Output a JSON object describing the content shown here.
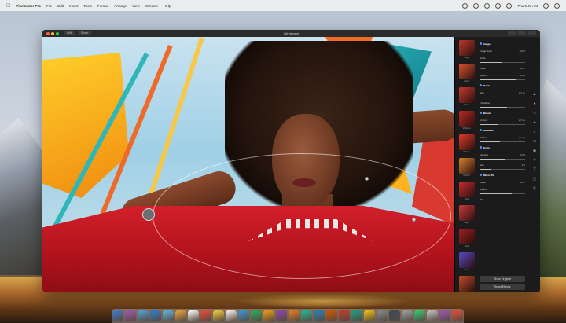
{
  "menubar": {
    "app_name": "Pixelmator Pro",
    "menus": [
      "File",
      "Edit",
      "Insert",
      "Tools",
      "Format",
      "Arrange",
      "View",
      "Window",
      "Help"
    ],
    "clock": "Thu 9:41 AM"
  },
  "window": {
    "title": "Windswept",
    "toolbar_buttons": [
      "Edit",
      "Share"
    ]
  },
  "panel": {
    "thumbnails": [
      {
        "label": "Image",
        "color": "#c0392b"
      },
      {
        "label": "Warm",
        "color": "#d9532f"
      },
      {
        "label": "Tones",
        "color": "#c43a2c"
      },
      {
        "label": "Shadows",
        "color": "#b82a22"
      },
      {
        "label": "Pattern",
        "color": "#e03a2a"
      },
      {
        "label": "Colorful",
        "color": "#d9802a"
      },
      {
        "label": "Vivid",
        "color": "#c72c2f"
      },
      {
        "label": "Bright",
        "color": "#ce3a3a"
      },
      {
        "label": "Dark",
        "color": "#a01e1e"
      },
      {
        "label": "Glow",
        "color": "#5a4ac7"
      },
      {
        "label": "Retro",
        "color": "#c0502a"
      }
    ],
    "settings": [
      {
        "label": "Image",
        "value": "",
        "header": true
      },
      {
        "label": "Image Ratio",
        "value": "100%",
        "header": false
      },
      {
        "label": "Scale",
        "value": "",
        "header": false,
        "slider": 0.5
      },
      {
        "label": "Angle",
        "value": "100°",
        "header": false
      },
      {
        "label": "Opacity",
        "value": "100%",
        "header": false,
        "slider": 0.8
      },
      {
        "label": "Pinch",
        "value": "",
        "header": true
      },
      {
        "label": "Size",
        "value": "2.6 px",
        "header": false,
        "slider": 0.3
      },
      {
        "label": "Transition",
        "value": "",
        "header": false,
        "slider": 0.6
      },
      {
        "label": "Bloom",
        "value": "",
        "header": true
      },
      {
        "label": "Amount",
        "value": "2.5 px",
        "header": false,
        "slider": 0.4
      },
      {
        "label": "Diameter",
        "value": "",
        "header": true
      },
      {
        "label": "Radius",
        "value": "3.2 px",
        "header": false,
        "slider": 0.45
      },
      {
        "label": "Grain",
        "value": "",
        "header": true
      },
      {
        "label": "Intensity",
        "value": "10%",
        "header": false,
        "slider": 0.55
      },
      {
        "label": "Size",
        "value": "2%",
        "header": false,
        "slider": 0.25
      },
      {
        "label": "Mirror Tilt",
        "value": "",
        "header": true
      },
      {
        "label": "Angle",
        "value": "100°",
        "header": false
      },
      {
        "label": "Radius",
        "value": "",
        "header": false,
        "slider": 0.7
      },
      {
        "label": "Blur",
        "value": "",
        "header": false,
        "slider": 0.65
      }
    ],
    "buttons": {
      "show_original": "Show Original",
      "reset_effects": "Reset Effects"
    }
  },
  "dock": {
    "icons": [
      "#3a7bd5",
      "#9b59b6",
      "#4aa3df",
      "#2c7fd1",
      "#5bb8e8",
      "#e9a23b",
      "#ffffff",
      "#e74c3c",
      "#f4d03f",
      "#f7f7f7",
      "#3498db",
      "#27ae60",
      "#f39c12",
      "#8e44ad",
      "#e67e22",
      "#1abc9c",
      "#2980b9",
      "#d35400",
      "#c0392b",
      "#16a085",
      "#f1c40f",
      "#7f8c8d",
      "#34495e",
      "#95a5a6",
      "#2ecc71",
      "#bdc3c7",
      "#9b59b6",
      "#e74c3c"
    ]
  }
}
